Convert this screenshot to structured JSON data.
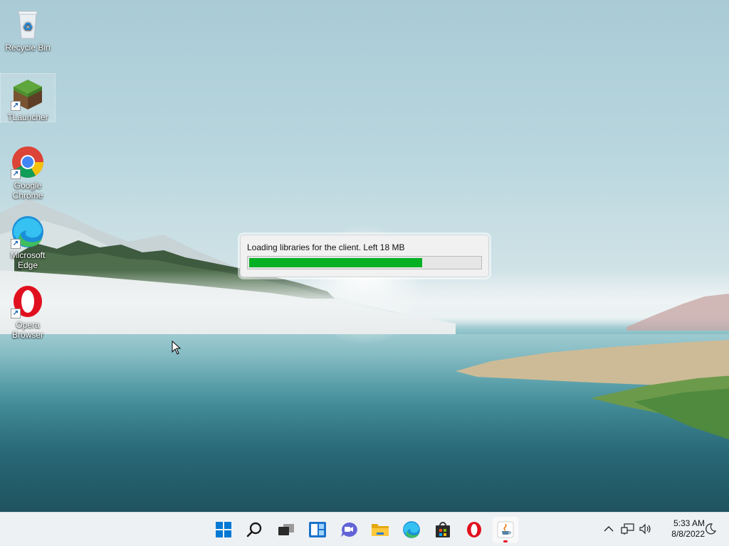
{
  "desktop": {
    "icons": [
      {
        "label": "Recycle Bin",
        "icon": "recycle-bin-icon"
      },
      {
        "label": "TLauncher",
        "icon": "tlauncher-icon"
      },
      {
        "label": "Google Chrome",
        "icon": "chrome-icon"
      },
      {
        "label": "Microsoft Edge",
        "icon": "edge-icon"
      },
      {
        "label": "Opera Browser",
        "icon": "opera-icon"
      }
    ]
  },
  "loader": {
    "message": "Loading libraries for the client. Left 18 MB",
    "progress": 0.75,
    "bar_color": "#06b025"
  },
  "taskbar": {
    "apps": [
      {
        "name": "start",
        "icon": "windows-logo-icon"
      },
      {
        "name": "search",
        "icon": "search-icon"
      },
      {
        "name": "task-view",
        "icon": "task-view-icon"
      },
      {
        "name": "widgets",
        "icon": "widgets-icon"
      },
      {
        "name": "chat",
        "icon": "chat-icon"
      },
      {
        "name": "file-explorer",
        "icon": "folder-icon"
      },
      {
        "name": "edge",
        "icon": "edge-icon"
      },
      {
        "name": "store",
        "icon": "store-icon"
      },
      {
        "name": "opera",
        "icon": "opera-icon"
      },
      {
        "name": "java",
        "icon": "java-icon"
      }
    ],
    "clock": {
      "time": "5:33 AM",
      "date": "8/8/2022"
    },
    "tray": [
      "chevron-up-icon",
      "network-icon",
      "volume-icon",
      "moon-icon"
    ]
  }
}
